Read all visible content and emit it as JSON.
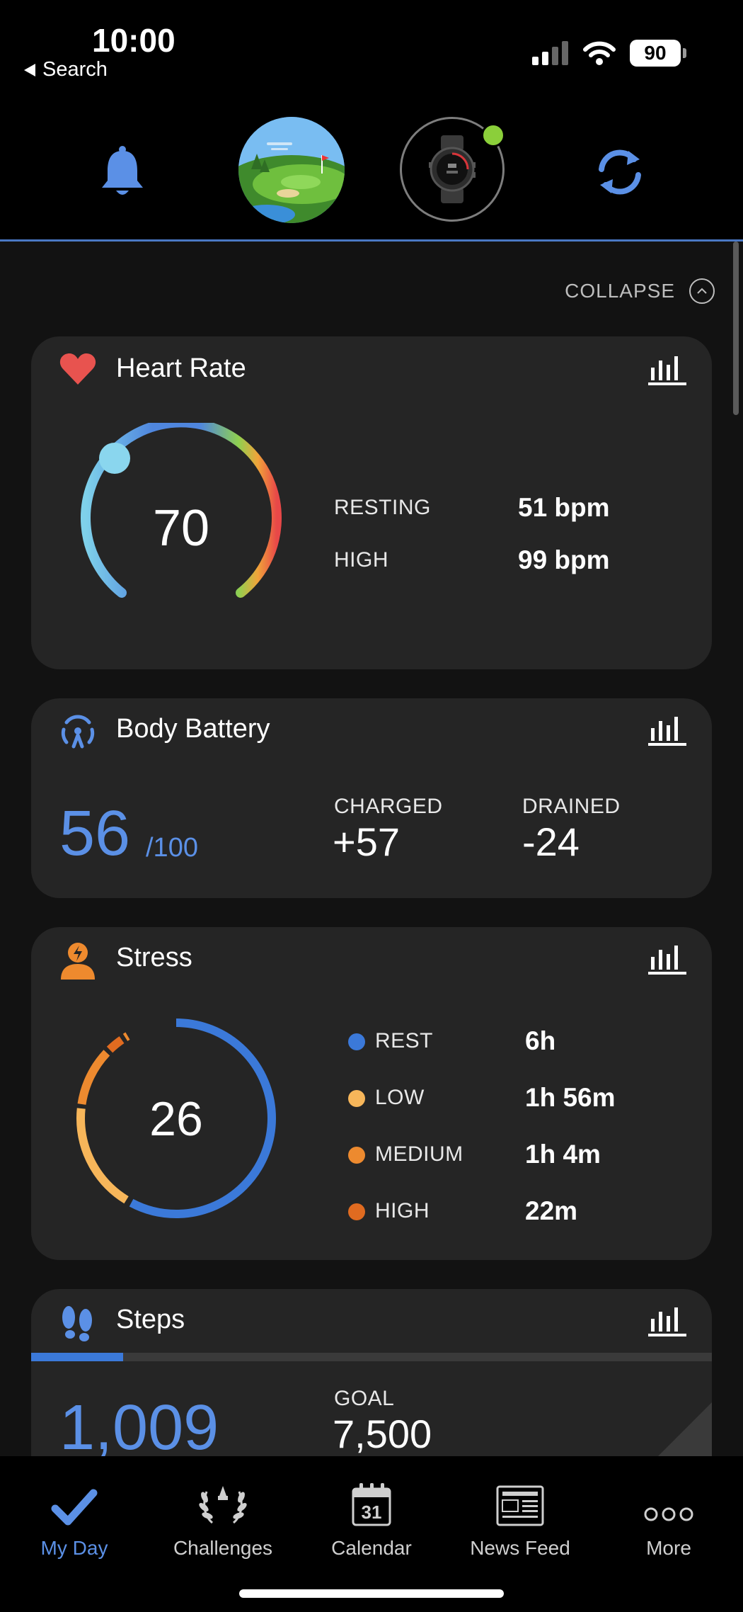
{
  "status": {
    "time": "10:00",
    "back_label": "Search",
    "battery": "90"
  },
  "collapse_label": "COLLAPSE",
  "heart_rate": {
    "title": "Heart Rate",
    "value": "70",
    "rows": [
      {
        "label": "RESTING",
        "value": "51 bpm"
      },
      {
        "label": "HIGH",
        "value": "99 bpm"
      }
    ]
  },
  "body_battery": {
    "title": "Body Battery",
    "value": "56",
    "max": "/100",
    "charged_label": "CHARGED",
    "charged_value": "+57",
    "drained_label": "DRAINED",
    "drained_value": "-24"
  },
  "stress": {
    "title": "Stress",
    "value": "26",
    "levels": [
      {
        "label": "REST",
        "value": "6h",
        "color": "#3b79d9"
      },
      {
        "label": "LOW",
        "value": "1h 56m",
        "color": "#f7b65a"
      },
      {
        "label": "MEDIUM",
        "value": "1h 4m",
        "color": "#ed8a2f"
      },
      {
        "label": "HIGH",
        "value": "22m",
        "color": "#e06b20"
      }
    ]
  },
  "steps": {
    "title": "Steps",
    "value": "1,009",
    "goal_label": "GOAL",
    "goal_value": "7,500",
    "progress": 0.135
  },
  "tabs": [
    {
      "label": "My Day",
      "icon": "checkmark-icon",
      "active": true
    },
    {
      "label": "Challenges",
      "icon": "laurel-icon",
      "active": false
    },
    {
      "label": "Calendar",
      "icon": "calendar-icon",
      "active": false,
      "day": "31"
    },
    {
      "label": "News Feed",
      "icon": "newspaper-icon",
      "active": false
    },
    {
      "label": "More",
      "icon": "more-icon",
      "active": false
    }
  ],
  "colors": {
    "accent": "#5b90e6",
    "card": "#252525",
    "heart": "#e8534f",
    "stress_icon": "#ee8a2e"
  }
}
